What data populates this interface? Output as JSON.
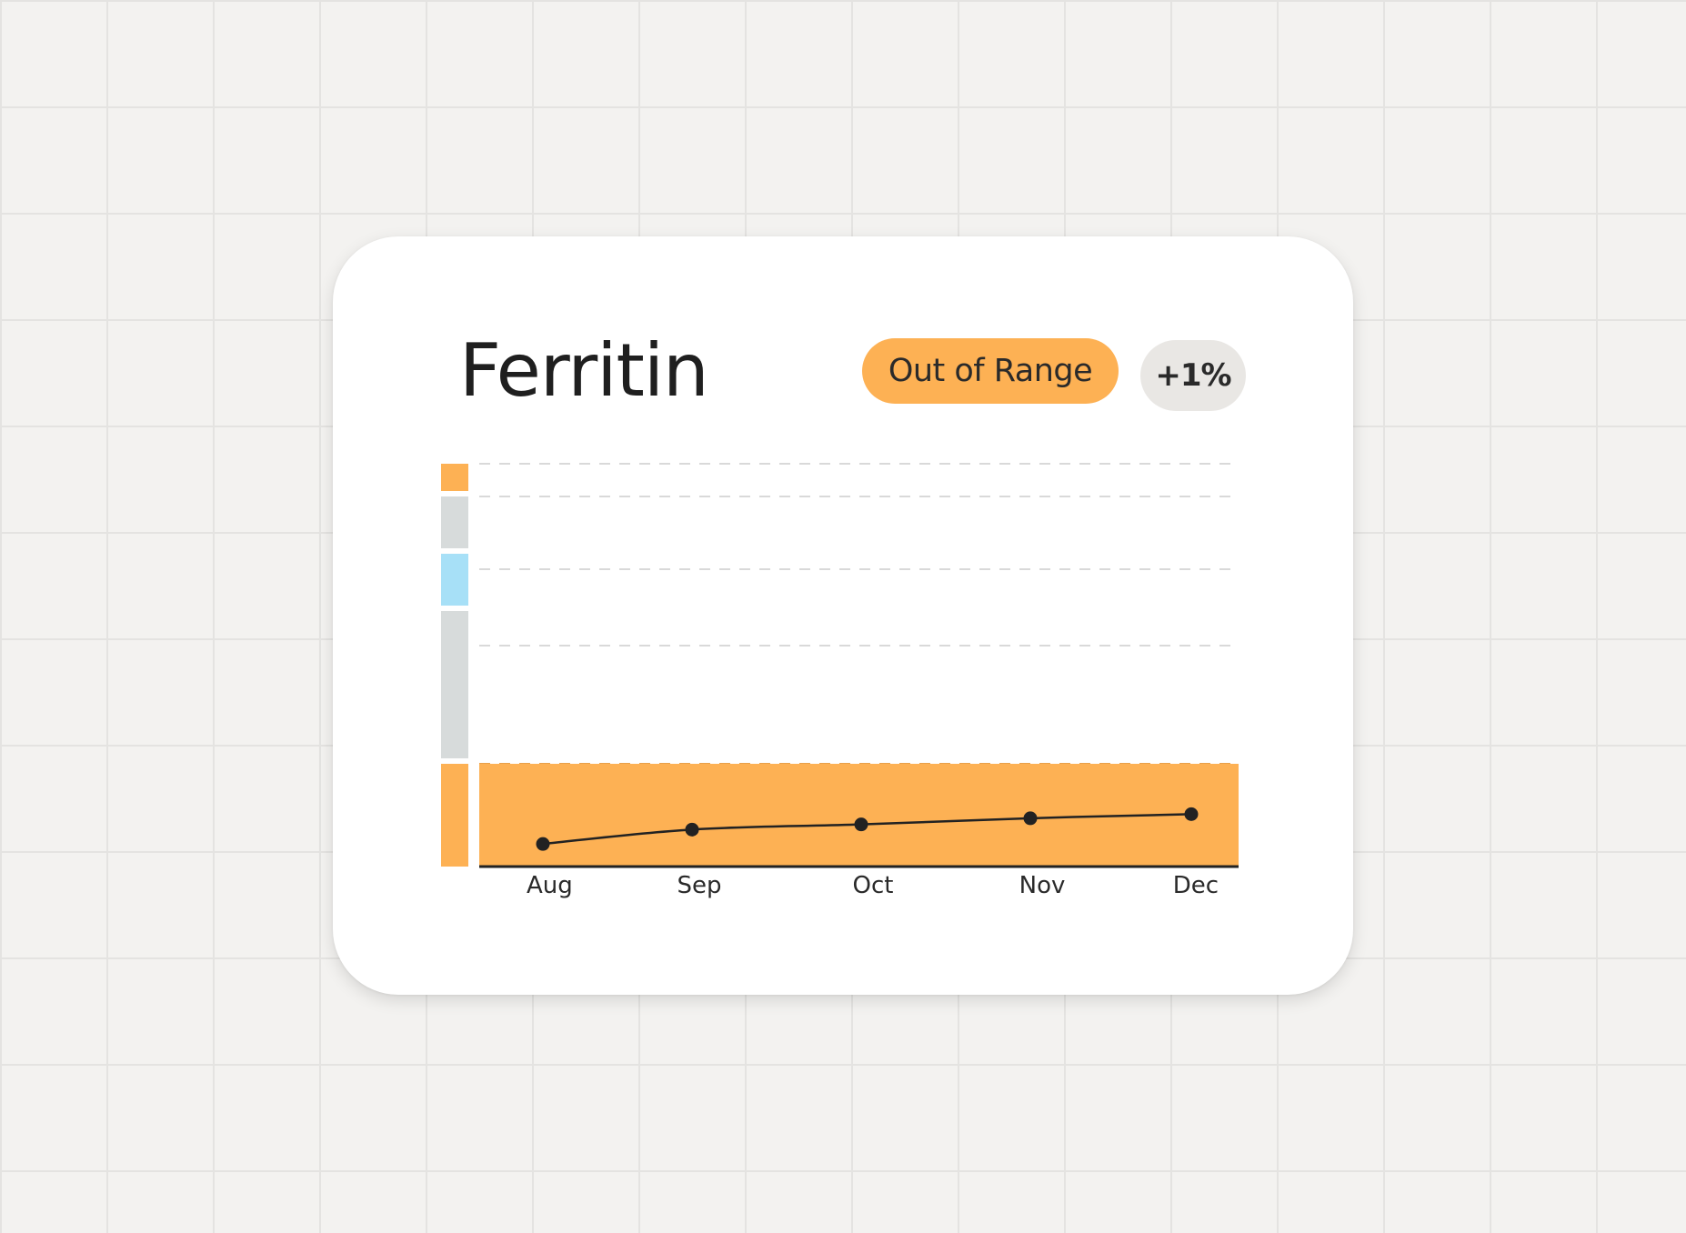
{
  "card": {
    "title": "Ferritin",
    "status_label": "Out of Range",
    "change_label": "+1%"
  },
  "colors": {
    "out_of_range": "#fdb154",
    "neutral_band": "#d7dbdb",
    "optimal_band": "#a7e0f7",
    "line": "#222222",
    "gridline": "#d9d9d9"
  },
  "chart_data": {
    "type": "line",
    "categories": [
      "Aug",
      "Sep",
      "Oct",
      "Nov",
      "Dec"
    ],
    "values": [
      0.22,
      0.36,
      0.41,
      0.47,
      0.51
    ],
    "grid": "dashed horizontal",
    "current_zone": "out_of_range_low",
    "range_bands": [
      {
        "zone": "out_of_range_high",
        "color": "#fdb154"
      },
      {
        "zone": "normal_high",
        "color": "#d7dbdb"
      },
      {
        "zone": "optimal",
        "color": "#a7e0f7"
      },
      {
        "zone": "normal_low",
        "color": "#d7dbdb"
      },
      {
        "zone": "out_of_range_low",
        "color": "#fdb154"
      }
    ]
  }
}
